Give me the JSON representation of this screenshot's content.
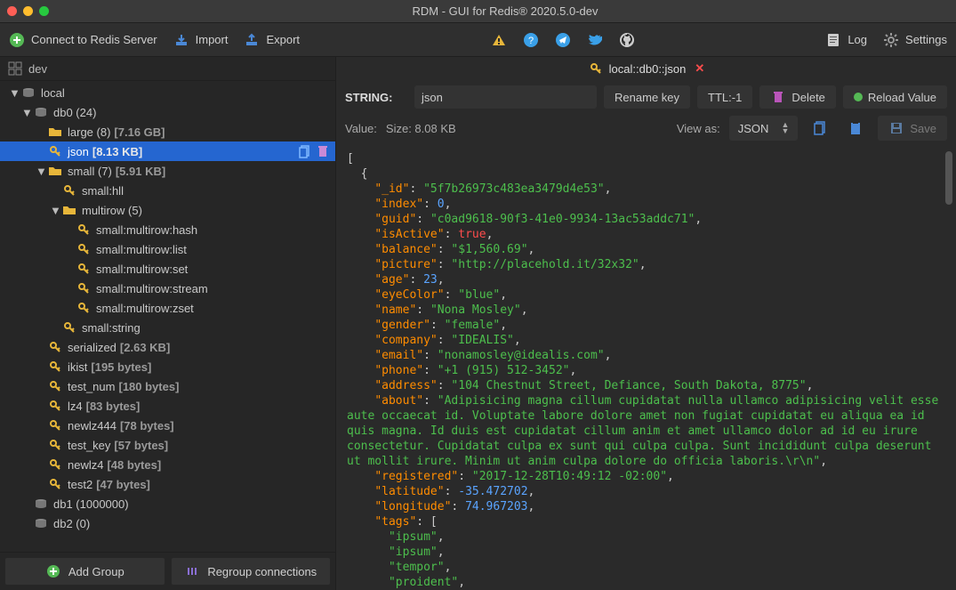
{
  "window": {
    "title": "RDM - GUI for Redis® 2020.5.0-dev"
  },
  "toolbar": {
    "connect": "Connect to Redis Server",
    "import": "Import",
    "export": "Export",
    "log": "Log",
    "settings": "Settings"
  },
  "sidebar": {
    "top_label": "dev",
    "nodes": [
      {
        "depth": 0,
        "arrow": "▼",
        "icon": "db",
        "label": "local"
      },
      {
        "depth": 1,
        "arrow": "▼",
        "icon": "db",
        "label": "db0",
        "meta": "(24)"
      },
      {
        "depth": 2,
        "arrow": "",
        "icon": "folder",
        "label": "large (8)",
        "size": "[7.16 GB]"
      },
      {
        "depth": 2,
        "arrow": "",
        "icon": "key",
        "label": "json",
        "size": "[8.13 KB]",
        "selected": true,
        "actions": true
      },
      {
        "depth": 2,
        "arrow": "▼",
        "icon": "folder",
        "label": "small (7)",
        "size": "[5.91 KB]"
      },
      {
        "depth": 3,
        "arrow": "",
        "icon": "key",
        "label": "small:hll"
      },
      {
        "depth": 3,
        "arrow": "▼",
        "icon": "folder",
        "label": "multirow (5)"
      },
      {
        "depth": 4,
        "arrow": "",
        "icon": "key",
        "label": "small:multirow:hash"
      },
      {
        "depth": 4,
        "arrow": "",
        "icon": "key",
        "label": "small:multirow:list"
      },
      {
        "depth": 4,
        "arrow": "",
        "icon": "key",
        "label": "small:multirow:set"
      },
      {
        "depth": 4,
        "arrow": "",
        "icon": "key",
        "label": "small:multirow:stream"
      },
      {
        "depth": 4,
        "arrow": "",
        "icon": "key",
        "label": "small:multirow:zset"
      },
      {
        "depth": 3,
        "arrow": "",
        "icon": "key",
        "label": "small:string"
      },
      {
        "depth": 2,
        "arrow": "",
        "icon": "key",
        "label": "serialized",
        "size": "[2.63 KB]"
      },
      {
        "depth": 2,
        "arrow": "",
        "icon": "key",
        "label": "ikist",
        "size": "[195 bytes]"
      },
      {
        "depth": 2,
        "arrow": "",
        "icon": "key",
        "label": "test_num",
        "size": "[180 bytes]"
      },
      {
        "depth": 2,
        "arrow": "",
        "icon": "key",
        "label": "lz4",
        "size": "[83 bytes]"
      },
      {
        "depth": 2,
        "arrow": "",
        "icon": "key",
        "label": "newlz444",
        "size": "[78 bytes]"
      },
      {
        "depth": 2,
        "arrow": "",
        "icon": "key",
        "label": "test_key",
        "size": "[57 bytes]"
      },
      {
        "depth": 2,
        "arrow": "",
        "icon": "key",
        "label": "newlz4",
        "size": "[48 bytes]"
      },
      {
        "depth": 2,
        "arrow": "",
        "icon": "key",
        "label": "test2",
        "size": "[47 bytes]"
      },
      {
        "depth": 1,
        "arrow": "",
        "icon": "db",
        "label": "db1",
        "meta": "(1000000)"
      },
      {
        "depth": 1,
        "arrow": "",
        "icon": "db",
        "label": "db2",
        "meta": "(0)"
      }
    ],
    "footer": {
      "add_group": "Add Group",
      "regroup": "Regroup connections"
    }
  },
  "tab": {
    "label": "local::db0::json"
  },
  "key_editor": {
    "type_label": "STRING:",
    "key_value": "json",
    "rename": "Rename key",
    "ttl": "TTL:-1",
    "delete": "Delete",
    "reload": "Reload Value"
  },
  "value_bar": {
    "value_label": "Value:",
    "size_label": "Size: 8.08 KB",
    "view_as_label": "View as:",
    "view_as_value": "JSON",
    "save": "Save"
  },
  "code": [
    {
      "t": "pun",
      "indent": 0,
      "text": "["
    },
    {
      "t": "pun",
      "indent": 1,
      "text": "{"
    },
    {
      "t": "kv",
      "indent": 2,
      "key": "\"_id\"",
      "val": "\"5f7b26973c483ea3479d4e53\"",
      "vt": "str"
    },
    {
      "t": "kv",
      "indent": 2,
      "key": "\"index\"",
      "val": "0",
      "vt": "num"
    },
    {
      "t": "kv",
      "indent": 2,
      "key": "\"guid\"",
      "val": "\"c0ad9618-90f3-41e0-9934-13ac53addc71\"",
      "vt": "str"
    },
    {
      "t": "kv",
      "indent": 2,
      "key": "\"isActive\"",
      "val": "true",
      "vt": "bool"
    },
    {
      "t": "kv",
      "indent": 2,
      "key": "\"balance\"",
      "val": "\"$1,560.69\"",
      "vt": "str"
    },
    {
      "t": "kv",
      "indent": 2,
      "key": "\"picture\"",
      "val": "\"http://placehold.it/32x32\"",
      "vt": "str"
    },
    {
      "t": "kv",
      "indent": 2,
      "key": "\"age\"",
      "val": "23",
      "vt": "num"
    },
    {
      "t": "kv",
      "indent": 2,
      "key": "\"eyeColor\"",
      "val": "\"blue\"",
      "vt": "str"
    },
    {
      "t": "kv",
      "indent": 2,
      "key": "\"name\"",
      "val": "\"Nona Mosley\"",
      "vt": "str"
    },
    {
      "t": "kv",
      "indent": 2,
      "key": "\"gender\"",
      "val": "\"female\"",
      "vt": "str"
    },
    {
      "t": "kv",
      "indent": 2,
      "key": "\"company\"",
      "val": "\"IDEALIS\"",
      "vt": "str"
    },
    {
      "t": "kv",
      "indent": 2,
      "key": "\"email\"",
      "val": "\"nonamosley@idealis.com\"",
      "vt": "str"
    },
    {
      "t": "kv",
      "indent": 2,
      "key": "\"phone\"",
      "val": "\"+1 (915) 512-3452\"",
      "vt": "str"
    },
    {
      "t": "kv",
      "indent": 2,
      "key": "\"address\"",
      "val": "\"104 Chestnut Street, Defiance, South Dakota, 8775\"",
      "vt": "str"
    },
    {
      "t": "kv",
      "indent": 2,
      "key": "\"about\"",
      "val": "\"Adipisicing magna cillum cupidatat nulla ullamco adipisicing velit esse aute occaecat id. Voluptate labore dolore amet non fugiat cupidatat eu aliqua ea id quis magna. Id duis est cupidatat cillum anim et amet ullamco dolor ad id eu irure consectetur. Cupidatat culpa ex sunt qui culpa culpa. Sunt incididunt culpa deserunt ut mollit irure. Minim ut anim culpa dolore do officia laboris.\\r\\n\"",
      "vt": "str",
      "wrap": true
    },
    {
      "t": "kv",
      "indent": 2,
      "key": "\"registered\"",
      "val": "\"2017-12-28T10:49:12 -02:00\"",
      "vt": "str"
    },
    {
      "t": "kv",
      "indent": 2,
      "key": "\"latitude\"",
      "val": "-35.472702",
      "vt": "num"
    },
    {
      "t": "kv",
      "indent": 2,
      "key": "\"longitude\"",
      "val": "74.967203",
      "vt": "num"
    },
    {
      "t": "kopen",
      "indent": 2,
      "key": "\"tags\"",
      "open": "["
    },
    {
      "t": "str",
      "indent": 3,
      "val": "\"ipsum\""
    },
    {
      "t": "str",
      "indent": 3,
      "val": "\"ipsum\""
    },
    {
      "t": "str",
      "indent": 3,
      "val": "\"tempor\""
    },
    {
      "t": "str",
      "indent": 3,
      "val": "\"proident\""
    }
  ]
}
